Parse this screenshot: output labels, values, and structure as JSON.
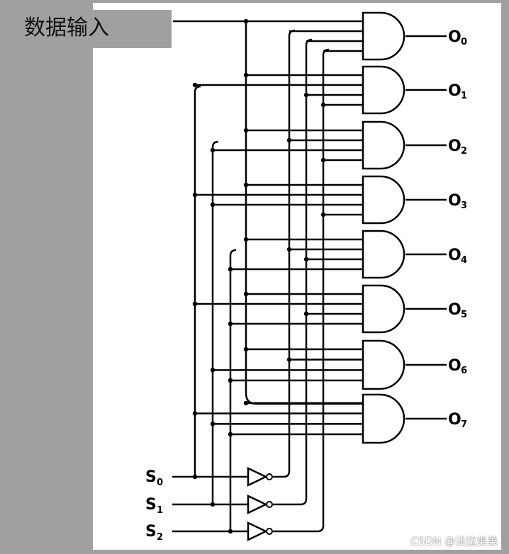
{
  "title_label": "数据输入",
  "outputs": [
    {
      "name": "O",
      "index": "0"
    },
    {
      "name": "O",
      "index": "1"
    },
    {
      "name": "O",
      "index": "2"
    },
    {
      "name": "O",
      "index": "3"
    },
    {
      "name": "O",
      "index": "4"
    },
    {
      "name": "O",
      "index": "5"
    },
    {
      "name": "O",
      "index": "6"
    },
    {
      "name": "O",
      "index": "7"
    }
  ],
  "selects": [
    {
      "name": "S",
      "index": "0"
    },
    {
      "name": "S",
      "index": "1"
    },
    {
      "name": "S",
      "index": "2"
    }
  ],
  "watermark": "CSDN @法拉弟弟",
  "colors": {
    "background": "#a0a0a0",
    "panel": "#ffffff",
    "wire": "#000000"
  }
}
